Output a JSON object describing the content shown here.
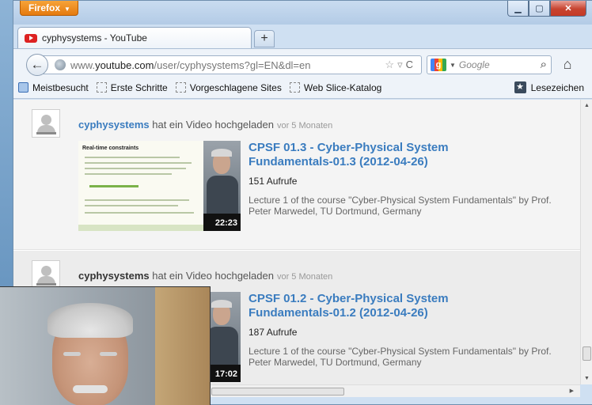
{
  "browser": {
    "app_button": "Firefox",
    "tab_title": "cyphysystems - YouTube",
    "url_prefix": "www.",
    "url_host": "youtube.com",
    "url_path": "/user/cyphysystems?gl=EN&dl=en",
    "search_placeholder": "Google",
    "new_tab_label": "+"
  },
  "bookmarks": {
    "items": [
      "Meistbesucht",
      "Erste Schritte",
      "Vorgeschlagene Sites",
      "Web Slice-Katalog"
    ],
    "right_label": "Lesezeichen"
  },
  "feed": [
    {
      "user": "cyphysystems",
      "action": " hat ein Video hochgeladen",
      "ago": "vor 5 Monaten",
      "title": "CPSF 01.3 - Cyber-Physical System Fundamentals-01.3 (2012-04-26)",
      "views": "151 Aufrufe",
      "description": "Lecture 1 of the course \"Cyber-Physical System Fundamentals\" by Prof. Peter Marwedel, TU Dortmund, Germany",
      "duration": "22:23",
      "slide_title": "Real-time constraints"
    },
    {
      "user": "cyphysystems",
      "action": " hat ein Video hochgeladen",
      "ago": "vor 5 Monaten",
      "title": "CPSF 01.2 - Cyber-Physical System Fundamentals-01.2 (2012-04-26)",
      "views": "187 Aufrufe",
      "description": "Lecture 1 of the course \"Cyber-Physical System Fundamentals\" by Prof. Peter Marwedel, TU Dortmund, Germany",
      "duration": "17:02"
    }
  ]
}
